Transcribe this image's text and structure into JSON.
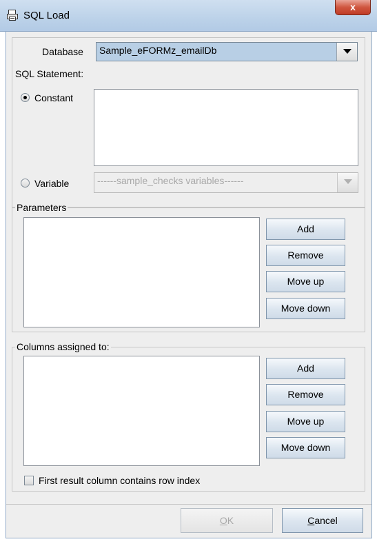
{
  "window": {
    "title": "SQL Load",
    "icon": "print-icon",
    "close_label": "x"
  },
  "database": {
    "label": "Database",
    "selected": "Sample_eFORMz_emailDb"
  },
  "sql_statement": {
    "label": "SQL Statement:",
    "constant_label": "Constant",
    "constant_selected": true,
    "constant_value": "",
    "variable_label": "Variable",
    "variable_selected": false,
    "variable_combo_value": "------sample_checks variables------"
  },
  "parameters": {
    "label": "Parameters",
    "items": [],
    "buttons": {
      "add": "Add",
      "remove": "Remove",
      "move_up": "Move up",
      "move_down": "Move down"
    }
  },
  "columns": {
    "label": "Columns assigned to:",
    "items": [],
    "buttons": {
      "add": "Add",
      "remove": "Remove",
      "move_up": "Move up",
      "move_down": "Move down"
    },
    "row_index_checkbox_label": "First result column contains row index",
    "row_index_checked": false
  },
  "footer": {
    "ok_mnemonic": "O",
    "ok_rest": "K",
    "cancel_mnemonic": "C",
    "cancel_rest": "ancel"
  }
}
